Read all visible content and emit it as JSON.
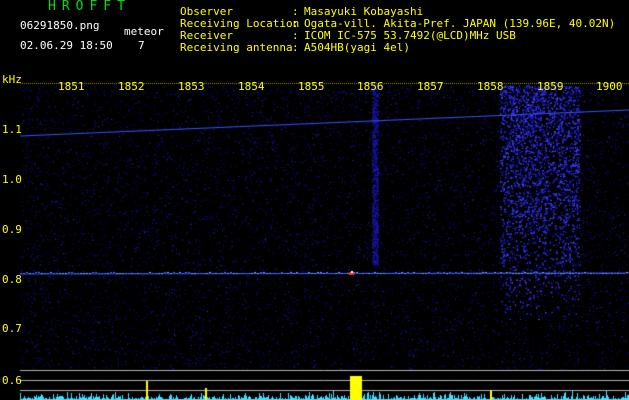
{
  "header": {
    "station": "HROFFT",
    "filename": "06291850.png",
    "datetime": "02.06.29 18:50",
    "meteor_label": "meteor",
    "meteor_count": "7"
  },
  "info": [
    {
      "key": "Observer",
      "sep": ":",
      "value": "Masayuki Kobayashi"
    },
    {
      "key": "Receiving Location",
      "sep": ":",
      "value": "Ogata-vill. Akita-Pref. JAPAN (139.96E, 40.02N)"
    },
    {
      "key": "Receiver",
      "sep": ":",
      "value": "ICOM IC-575 53.7492(@LCD)MHz USB"
    },
    {
      "key": "Receiving antenna",
      "sep": ":",
      "value": "A504HB(yagi 4el)"
    }
  ],
  "axis": {
    "unit": "kHz",
    "time_ticks": [
      "1851",
      "1852",
      "1853",
      "1854",
      "1855",
      "1856",
      "1857",
      "1858",
      "1859",
      "1900"
    ],
    "freq_ticks": [
      "1.1",
      "1.0",
      "0.9",
      "0.8",
      "0.7",
      "0.6"
    ]
  },
  "colors": {
    "background": "#000000",
    "noise": "#1a1ad0",
    "trace": "#3355ff",
    "text_white": "#ffffff",
    "text_yellow": "#ffff00",
    "title_green": "#00e000",
    "meteor_yellow": "#ffff00",
    "level_cyan": "#40e0ff"
  }
}
